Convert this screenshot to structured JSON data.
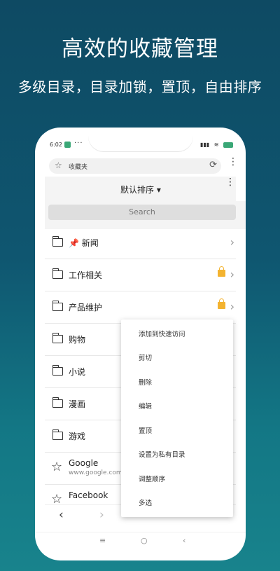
{
  "promo": {
    "title": "高效的收藏管理",
    "subtitle": "多级目录，目录加锁，置顶，自由排序"
  },
  "status_bar": {
    "time": "6:02",
    "more": "···",
    "signal": "▮▮▮",
    "wifi": "≋"
  },
  "browser": {
    "page_title": "收藏夹",
    "star_icon": "☆",
    "reload_icon": "⟳",
    "menu_icon": "⋮"
  },
  "toolbar": {
    "sort_label": "默认排序 ▾",
    "menu_icon": "⋮"
  },
  "search": {
    "placeholder": "Search"
  },
  "bookmarks": {
    "items": [
      {
        "icon": "folder-icon",
        "pin": "📌",
        "label": "新闻",
        "locked": false
      },
      {
        "icon": "folder-icon",
        "label": "工作相关",
        "locked": true
      },
      {
        "icon": "folder-icon",
        "label": "产品维护",
        "locked": true
      },
      {
        "icon": "folder-icon",
        "label": "购物",
        "locked": false
      },
      {
        "icon": "folder-icon",
        "label": "小说",
        "locked": false
      },
      {
        "icon": "folder-icon",
        "label": "漫画",
        "locked": false
      },
      {
        "icon": "folder-icon",
        "label": "游戏",
        "locked": false
      },
      {
        "icon": "star-icon",
        "label": "Google",
        "url": "www.google.com"
      },
      {
        "icon": "star-icon",
        "label": "Facebook"
      }
    ]
  },
  "context_menu": {
    "items": [
      "添加到快速访问",
      "剪切",
      "删除",
      "编辑",
      "置顶",
      "设置为私有目录",
      "调整顺序",
      "多选"
    ]
  },
  "nav": {
    "back": "‹",
    "forward": "›"
  },
  "sys_nav": {
    "menu": "≡",
    "home": "○",
    "back": "‹"
  },
  "colors": {
    "accent": "#3aa776",
    "lock": "#f3b330",
    "bg_top": "#0e4a63",
    "bg_bottom": "#18838c"
  }
}
